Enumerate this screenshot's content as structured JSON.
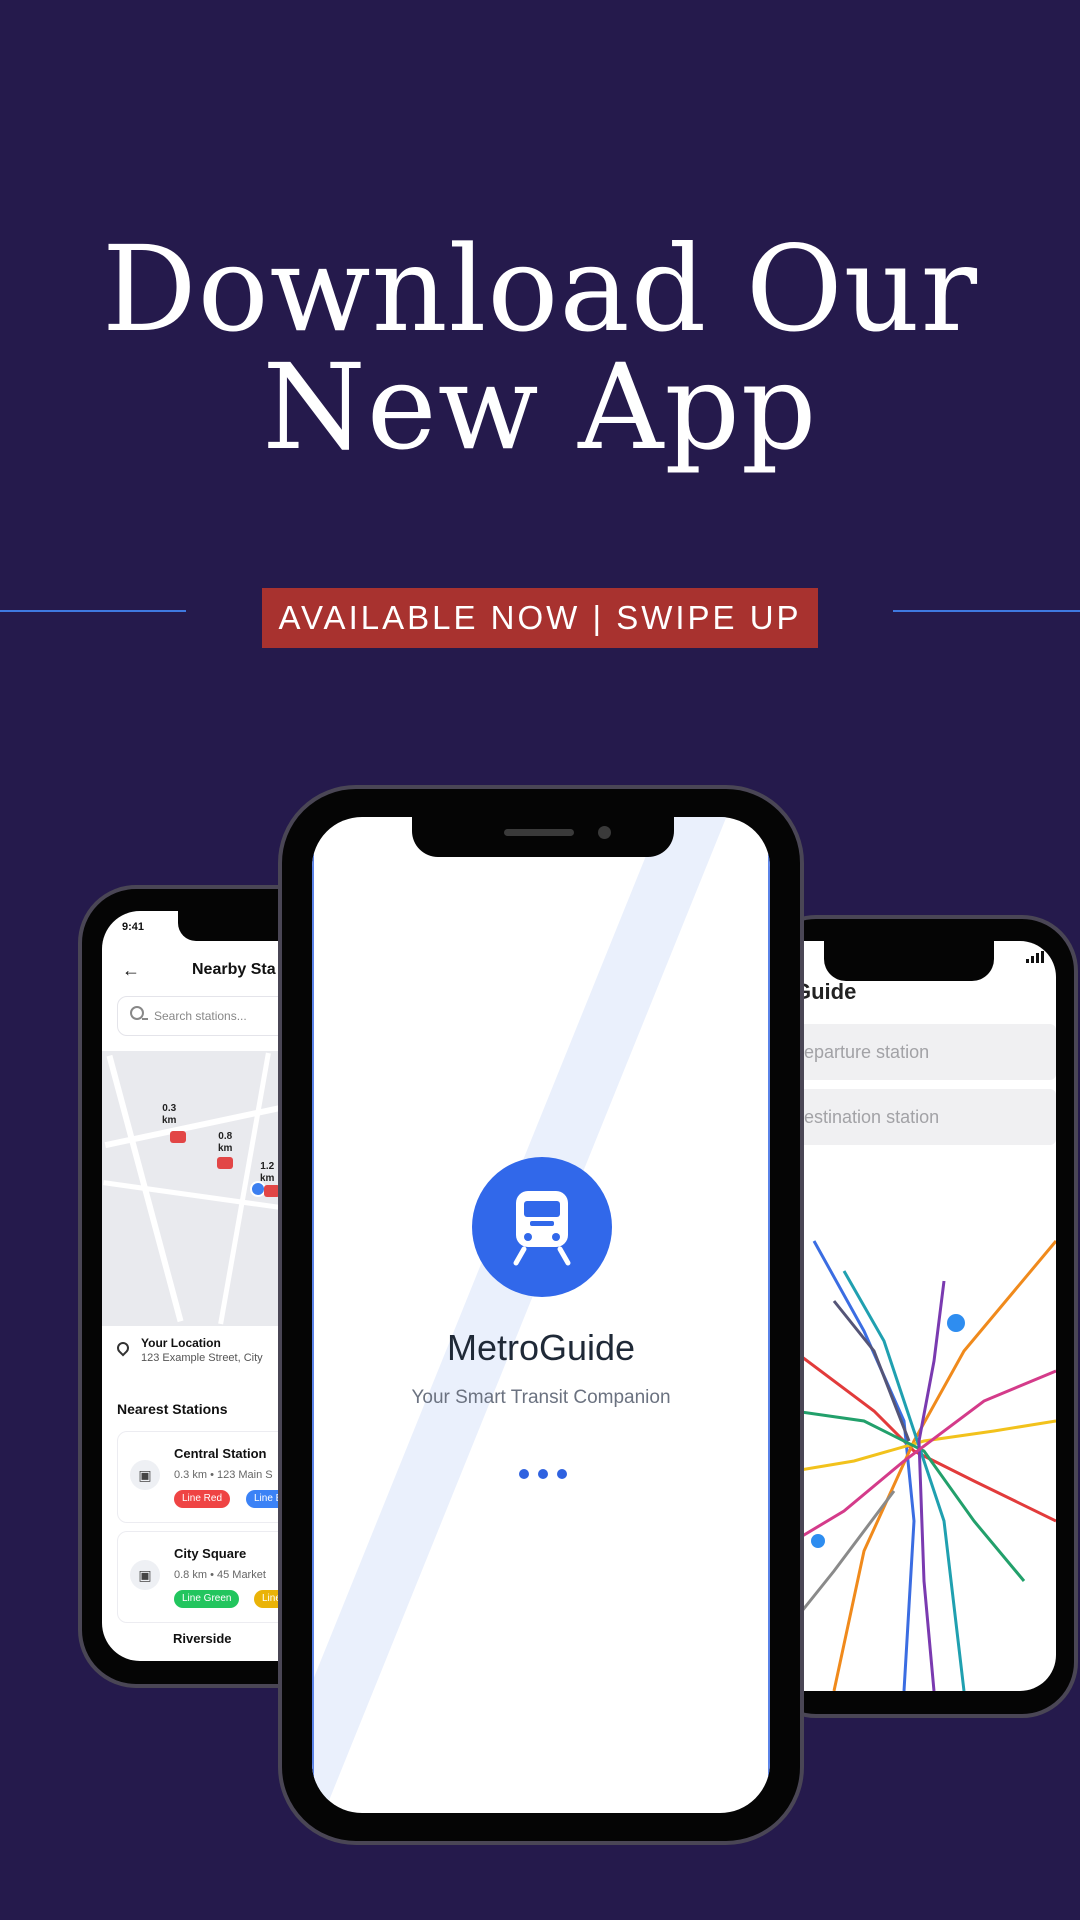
{
  "headline": {
    "line1": "Download Our",
    "line2": "New App"
  },
  "cta": {
    "label": "AVAILABLE NOW | SWIPE UP"
  },
  "colors": {
    "background": "#251a4c",
    "cta": "#a8322f",
    "accent_line": "#3f79e0",
    "app_blue": "#3168ea"
  },
  "left_screen": {
    "status_time": "9:41",
    "title": "Nearby Sta",
    "search_placeholder": "Search stations...",
    "map_labels": [
      "0.3\nkm",
      "0.8\nkm",
      "1.2\nkm"
    ],
    "location_title": "Your Location",
    "location_address": "123 Example Street, City",
    "section_title": "Nearest Stations",
    "stations": [
      {
        "name": "Central Station",
        "distance": "0.3 km",
        "address": "123 Main S",
        "lines": [
          "Line Red",
          "Line Blue"
        ]
      },
      {
        "name": "City Square",
        "distance": "0.8 km",
        "address": "45 Market",
        "lines": [
          "Line Green",
          "Line Ye"
        ]
      }
    ],
    "partial_station": "Riverside"
  },
  "center_screen": {
    "app_name": "MetroGuide",
    "tagline": "Your Smart Transit Companion"
  },
  "right_screen": {
    "title": "Guide",
    "departure_placeholder": "departure station",
    "destination_placeholder": "destination station"
  }
}
